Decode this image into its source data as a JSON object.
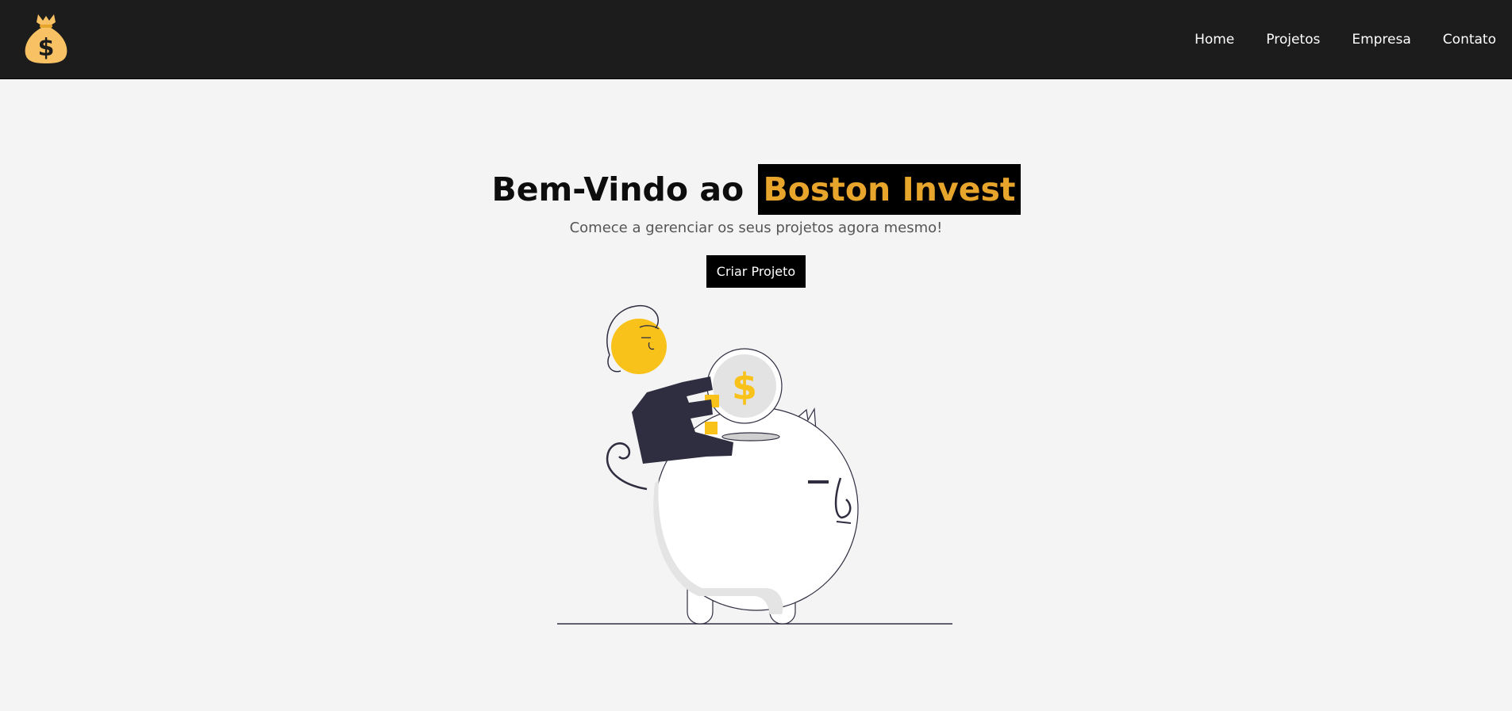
{
  "nav": {
    "links": [
      "Home",
      "Projetos",
      "Empresa",
      "Contato"
    ]
  },
  "hero": {
    "title_prefix": "Bem-Vindo ao",
    "title_brand": "Boston Invest",
    "subtitle": "Comece a gerenciar os seus projetos agora mesmo!",
    "cta_label": "Criar Projeto"
  },
  "icons": {
    "logo": "money-bag-icon",
    "coin_symbol": "$"
  },
  "colors": {
    "navbar_bg": "#1c1c1c",
    "page_bg": "#f4f4f4",
    "brand_gold": "#e8a52b",
    "accent_yellow": "#f9c21b",
    "dark_navy": "#2f2e41"
  }
}
